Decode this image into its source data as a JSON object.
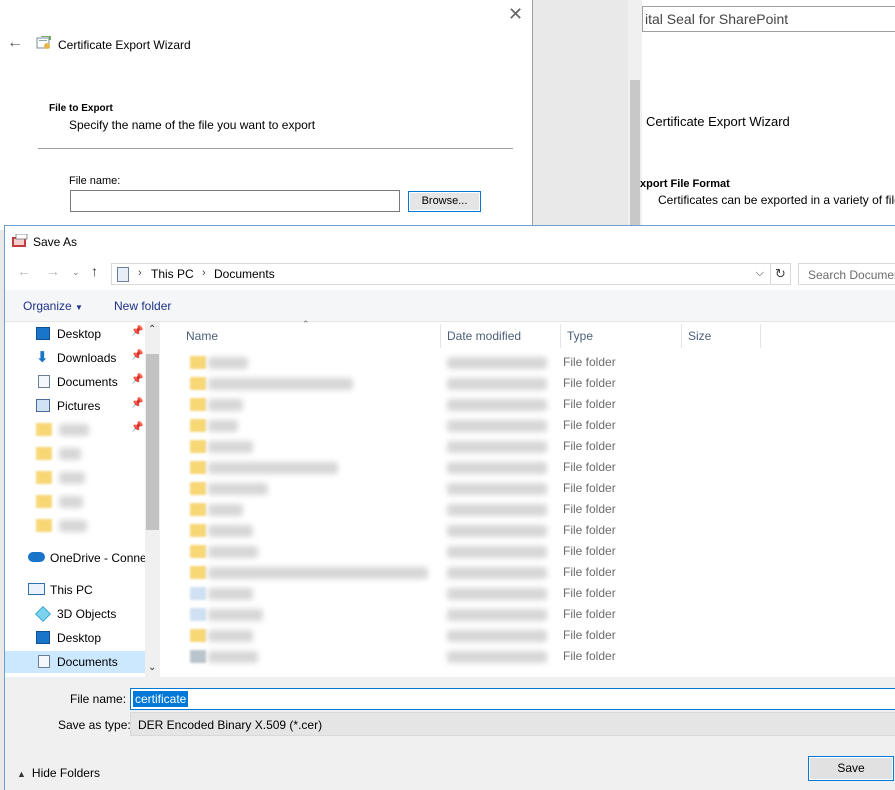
{
  "background_window": {
    "title_fragment": "ital Seal for SharePoint",
    "wizard_title": "Certificate Export Wizard",
    "section_heading": "xport File Format",
    "section_desc": "Certificates can be exported in a variety of file fo"
  },
  "wizard": {
    "title": "Certificate Export Wizard",
    "section_heading": "File to Export",
    "section_desc": "Specify the name of the file you want to export",
    "file_name_label": "File name:",
    "file_name_value": "",
    "browse_label": "Browse..."
  },
  "save_as": {
    "title": "Save As",
    "address": {
      "segments": [
        "This PC",
        "Documents"
      ]
    },
    "search_placeholder": "Search Documents",
    "toolbar": {
      "organize_label": "Organize",
      "new_folder_label": "New folder"
    },
    "nav_pane": {
      "quick_access": [
        {
          "label": "Desktop",
          "icon": "desktop-icon",
          "pinned": true
        },
        {
          "label": "Downloads",
          "icon": "downloads-icon",
          "pinned": true
        },
        {
          "label": "Documents",
          "icon": "documents-icon",
          "pinned": true
        },
        {
          "label": "Pictures",
          "icon": "pictures-icon",
          "pinned": true
        }
      ],
      "onedrive_label": "OneDrive - Conne",
      "this_pc_label": "This PC",
      "this_pc_items": [
        {
          "label": "3D Objects",
          "icon": "3d-objects-icon"
        },
        {
          "label": "Desktop",
          "icon": "desktop-icon"
        },
        {
          "label": "Documents",
          "icon": "documents-icon",
          "selected": true
        }
      ]
    },
    "columns": {
      "name": "Name",
      "date_modified": "Date modified",
      "type": "Type",
      "size": "Size"
    },
    "rows": [
      {
        "type": "File folder"
      },
      {
        "type": "File folder"
      },
      {
        "type": "File folder"
      },
      {
        "type": "File folder"
      },
      {
        "type": "File folder"
      },
      {
        "type": "File folder"
      },
      {
        "type": "File folder"
      },
      {
        "type": "File folder"
      },
      {
        "type": "File folder"
      },
      {
        "type": "File folder"
      },
      {
        "type": "File folder"
      },
      {
        "type": "File folder"
      },
      {
        "type": "File folder"
      },
      {
        "type": "File folder"
      },
      {
        "type": "File folder"
      }
    ],
    "bottom": {
      "file_name_label": "File name:",
      "file_name_value": "certificate",
      "save_type_label": "Save as type:",
      "save_type_value": "DER Encoded Binary X.509 (*.cer)",
      "hide_folders_label": "Hide Folders",
      "save_label": "Save"
    }
  }
}
